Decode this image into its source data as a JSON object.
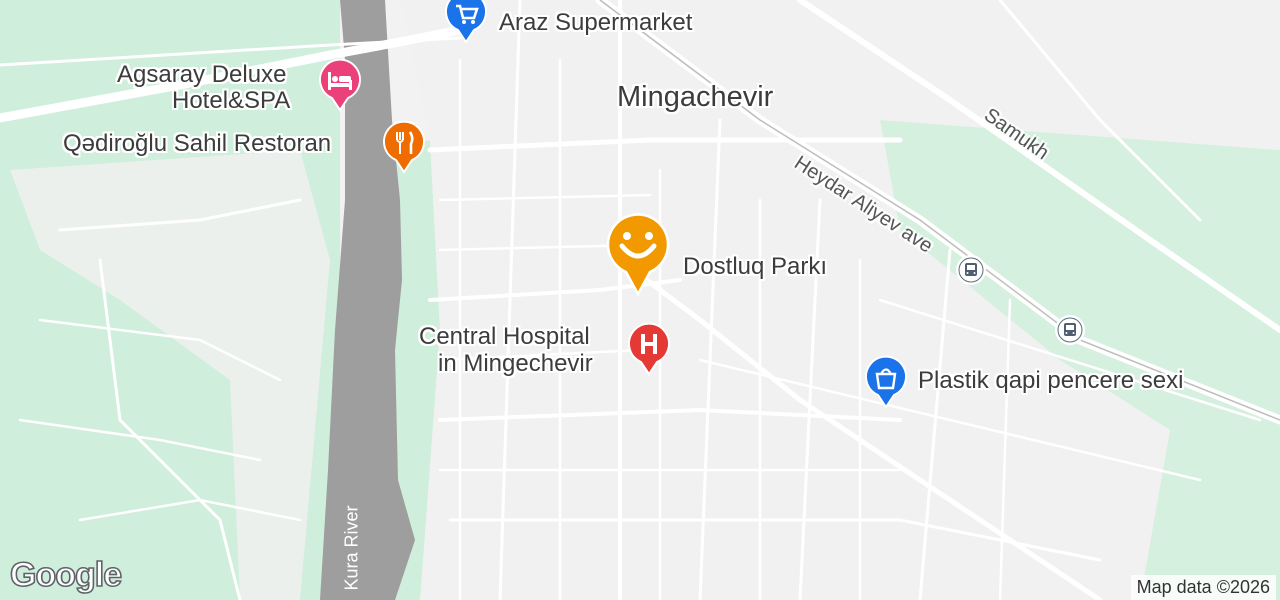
{
  "map": {
    "city_label": "Mingachevir",
    "river_label": "Kura River",
    "road_labels": {
      "heydar": "Heydar Aliyev ave",
      "samukh": "Samukh"
    },
    "places": {
      "supermarket": "Araz Supermarket",
      "hotel_line1": "Agsaray Deluxe",
      "hotel_line2": "Hotel&SPA",
      "restaurant": "Qədiroğlu Sahil Restoran",
      "park": "Dostluq Parkı",
      "hospital_line1": "Central Hospital",
      "hospital_line2": "in Mingechevir",
      "store": "Plastik qapi pencere sexi"
    },
    "icons": {
      "supermarket": "shopping-cart-icon",
      "hotel": "bed-icon",
      "restaurant": "fork-knife-icon",
      "park": "smiley-icon",
      "hospital": "hospital-h-icon",
      "store": "shopping-bag-icon",
      "bus": "bus-stop-icon"
    },
    "colors": {
      "park_green": "#cdeedb",
      "river": "#9e9e9e",
      "supermarket_pin": "#1a73e8",
      "hotel_pin": "#ec407a",
      "restaurant_pin": "#ef6c00",
      "park_pin": "#f29900",
      "hospital_pin": "#e53935",
      "store_pin": "#1a73e8"
    }
  },
  "branding": {
    "logo": "Google",
    "attribution": "Map data ©2026"
  }
}
